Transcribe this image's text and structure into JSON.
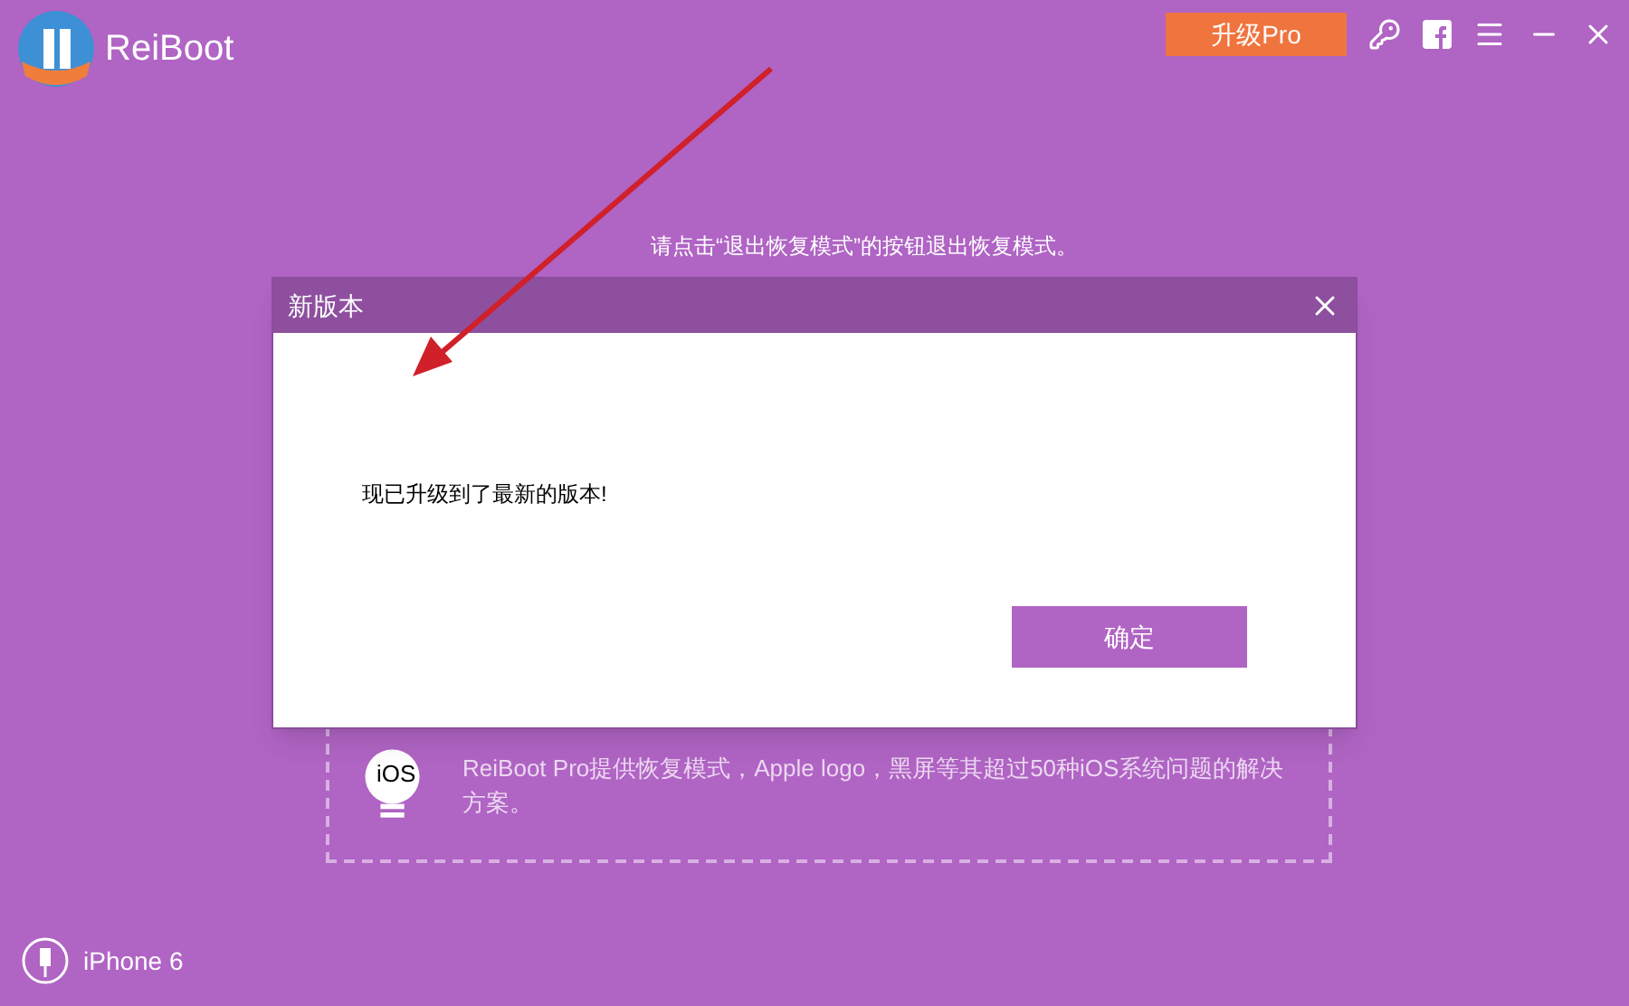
{
  "app": {
    "logo_text": "ReiBoot",
    "upgrade_button": "升级Pro",
    "hint": "请点击“退出恢复模式”的按钮退出恢复模式。"
  },
  "dialog": {
    "title": "新版本",
    "message": "现已升级到了最新的版本!",
    "ok_button": "确定"
  },
  "card": {
    "icon_label": "iOS",
    "description": "ReiBoot Pro提供恢复模式，Apple logo，黑屏等其超过50种iOS系统问题的解决方案。"
  },
  "device": {
    "name": "iPhone 6"
  }
}
